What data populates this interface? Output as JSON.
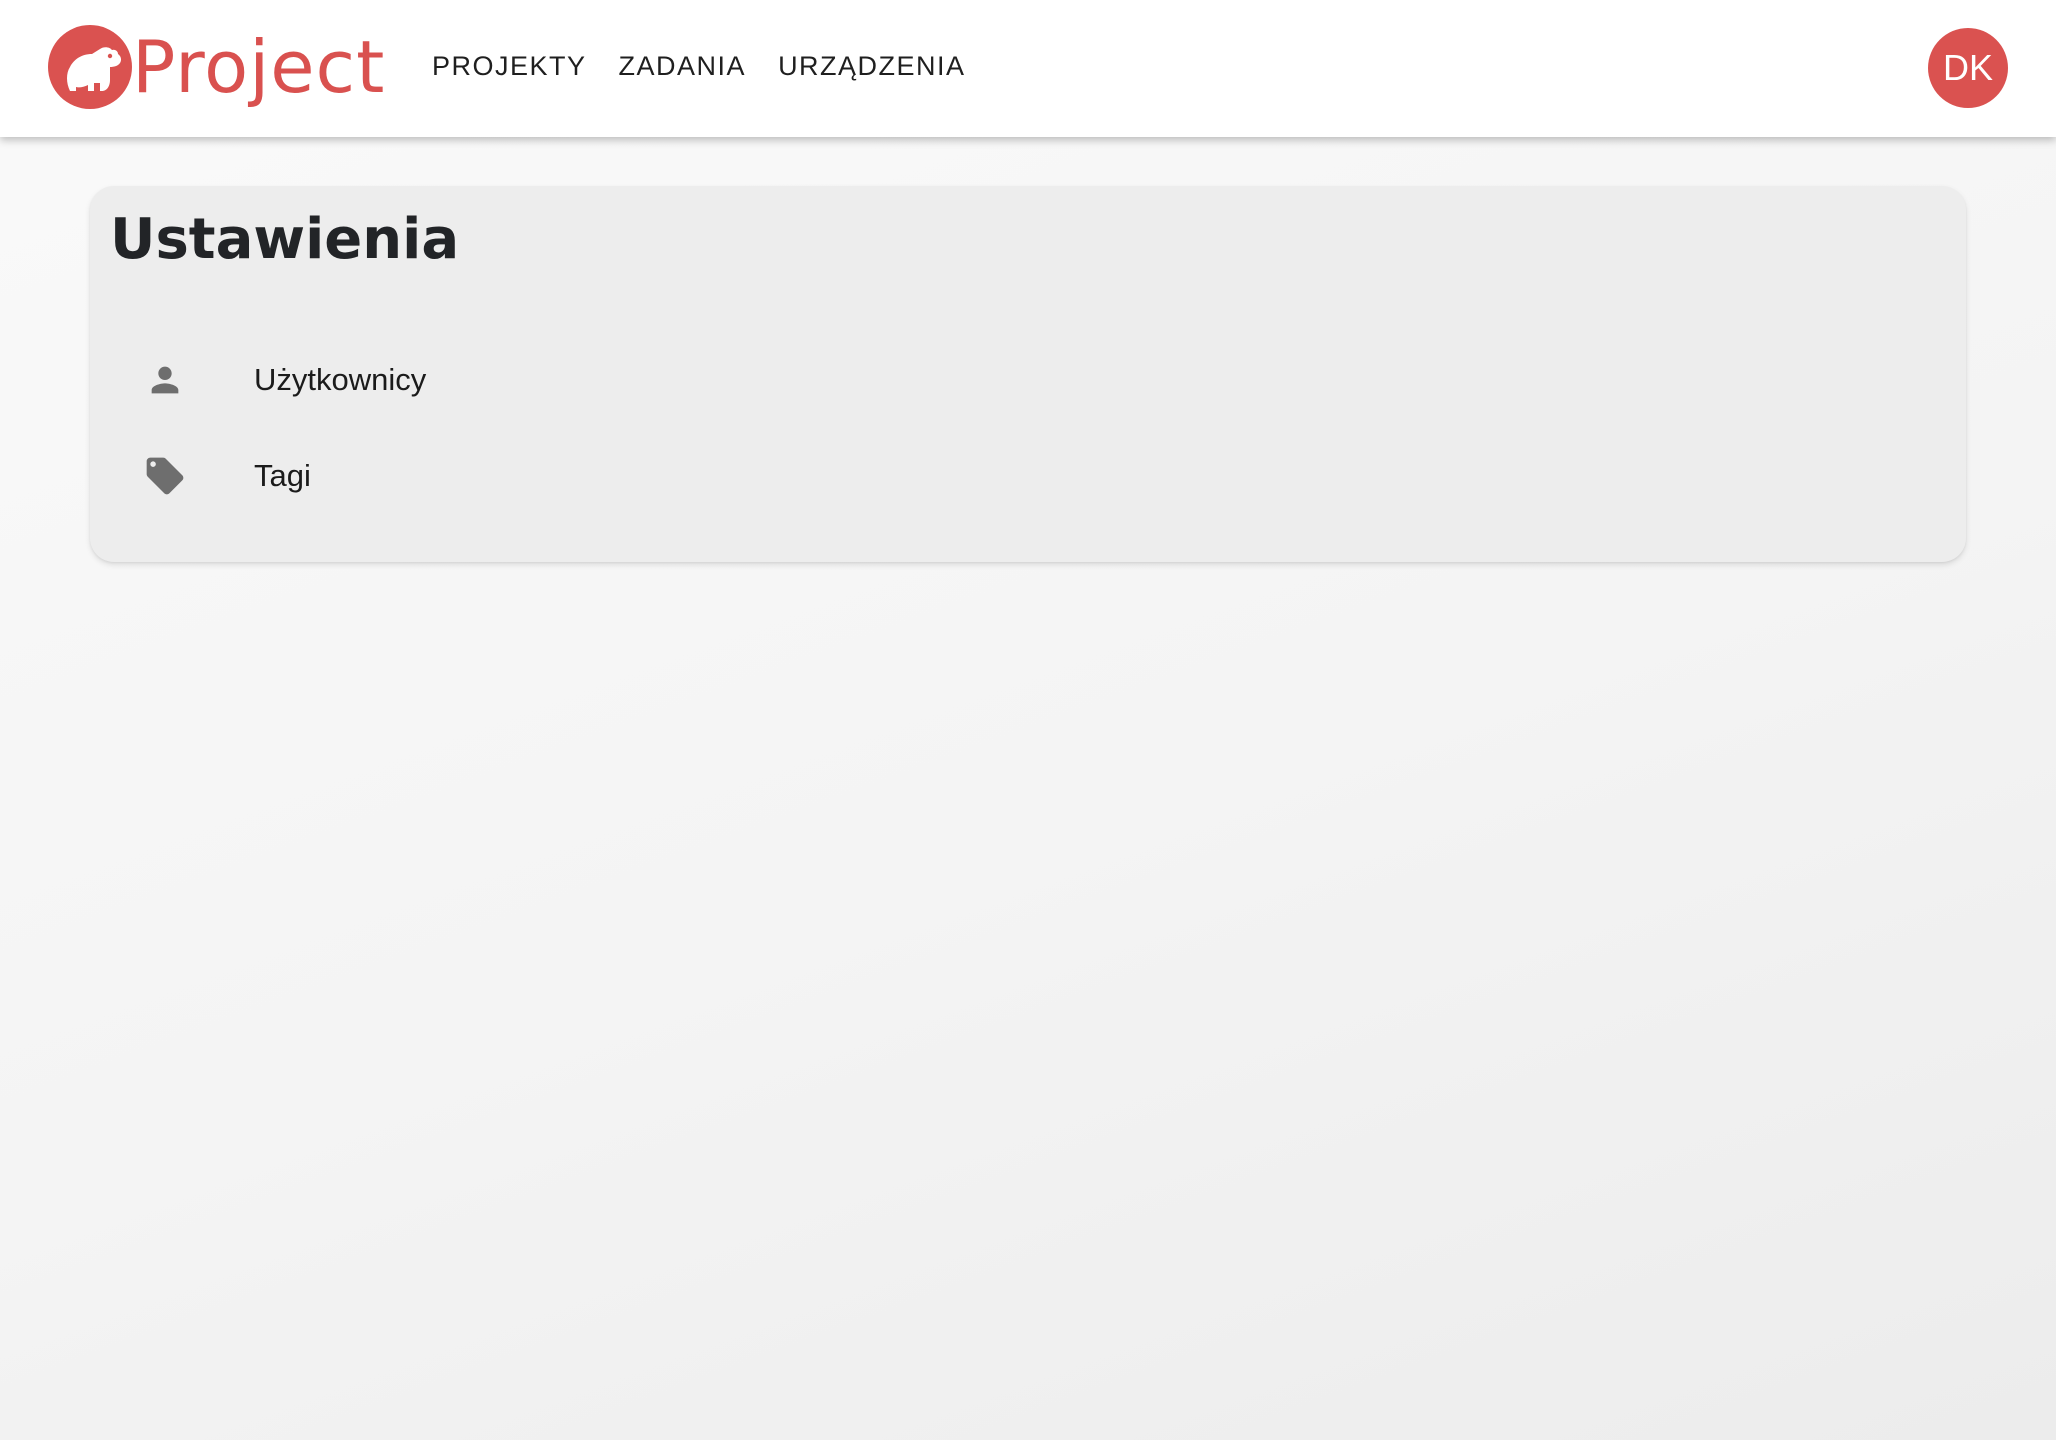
{
  "app": {
    "logo_text": "Project",
    "brand_color": "#da5250"
  },
  "nav": {
    "items": [
      {
        "label": "PROJEKTY"
      },
      {
        "label": "ZADANIA"
      },
      {
        "label": "URZĄDZENIA"
      }
    ]
  },
  "user": {
    "initials": "DK"
  },
  "settings": {
    "title": "Ustawienia",
    "items": [
      {
        "label": "Użytkownicy",
        "icon": "person-icon"
      },
      {
        "label": "Tagi",
        "icon": "tag-icon"
      }
    ]
  },
  "colors": {
    "icon": "#6e6e6e",
    "card_bg": "#ededed",
    "appbar_bg": "#ffffff"
  }
}
